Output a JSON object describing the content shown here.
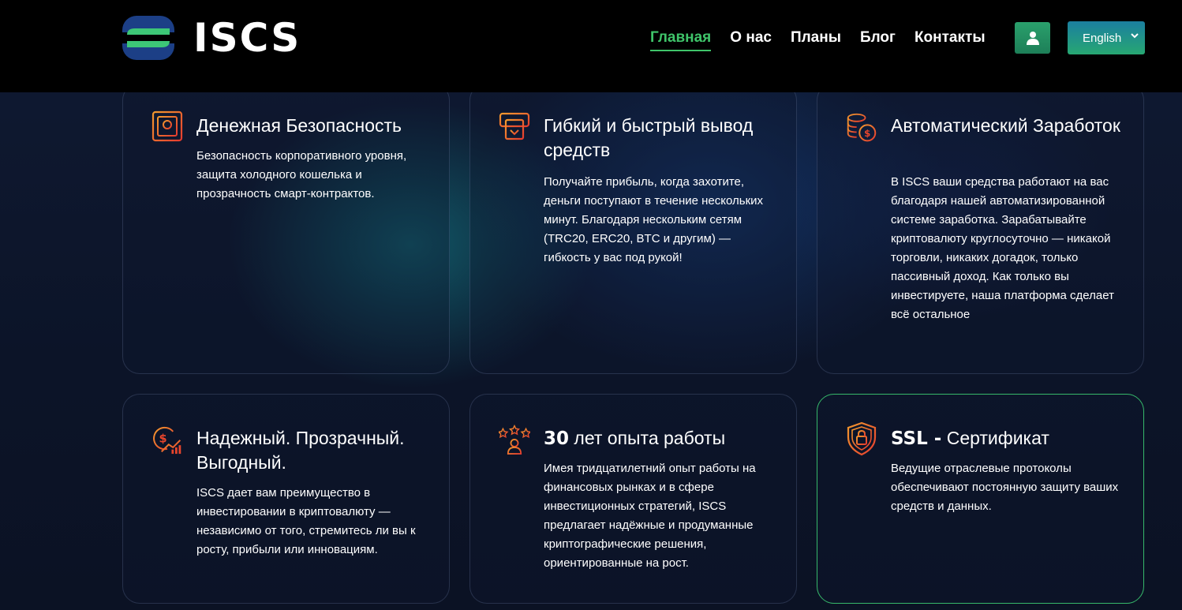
{
  "header": {
    "logo_text": "ISCS",
    "nav": [
      "Главная",
      "О нас",
      "Планы",
      "Блог",
      "Контакты"
    ],
    "active_nav": "Главная",
    "language": "English"
  },
  "colors": {
    "accent_green": "#3fc46a",
    "icon_red": "#e8452c",
    "icon_orange": "#f08a2a"
  },
  "cards": [
    {
      "icon": "safe-icon",
      "title": "Денежная Безопасность",
      "text": "Безопасность корпоративного уровня, защита холодного кошелька и прозрачность смарт-контрактов."
    },
    {
      "icon": "withdraw-icon",
      "title": "Гибкий и быстрый вывод средств",
      "text": "Получайте прибыль, когда захотите, деньги поступают в течение нескольких минут. Благодаря нескольким сетям (TRC20, ERC20, BTC и другим) — гибкость у вас под рукой!"
    },
    {
      "icon": "coins-icon",
      "title": "Автоматический Заработок",
      "text": "В ISCS ваши средства работают на вас благодаря нашей автоматизированной системе заработка. Зарабатывайте криптовалюту круглосуточно — никакой торговли, никаких догадок, только пассивный доход. Как только вы инвестируете, наша платформа сделает всё остальное"
    },
    {
      "icon": "dollar-growth-icon",
      "title": "Надежный. Прозрачный. Выгодный.",
      "text": "ISCS дает вам преимущество в инвестировании в криптовалюту — независимо от того, стремитесь ли вы к росту, прибыли или инновациям."
    },
    {
      "icon": "experience-stars-icon",
      "title_bold": "30",
      "title": " лет опыта работы",
      "text": "Имея тридцатилетний опыт работы на финансовых рынках и в сфере инвестиционных стратегий, ISCS предлагает надёжные и продуманные криптографические решения, ориентированные на рост."
    },
    {
      "icon": "shield-lock-icon",
      "title_bold": "SSL -",
      "title": " Сертификат",
      "text": "Ведущие отраслевые протоколы обеспечивают постоянную защиту ваших средств и данных."
    }
  ]
}
